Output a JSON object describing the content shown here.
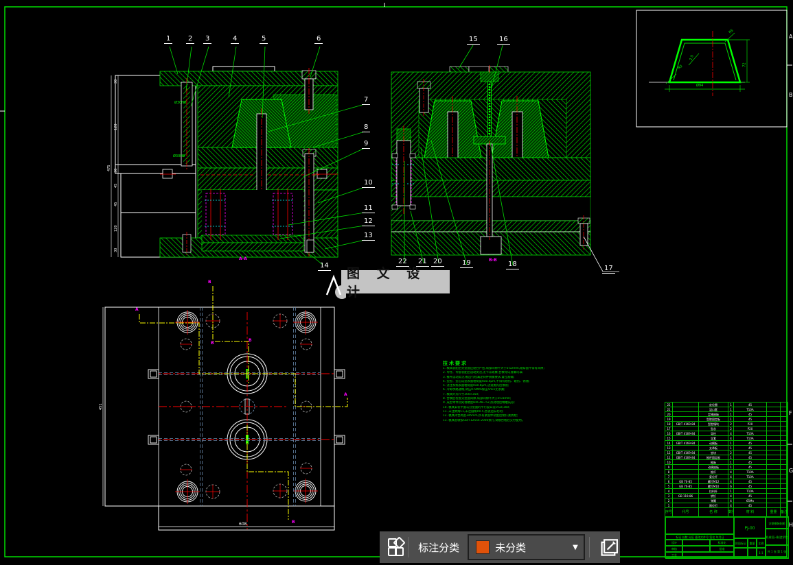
{
  "colors": {
    "line_green": "#00DC00",
    "hatch_green": "#00C800",
    "bright_green": "#00FF00",
    "red": "#FF0000",
    "yellow": "#FFFF00",
    "magenta": "#FF00FF",
    "cyan": "#00FFFF",
    "white": "#FFFFFF",
    "toolbar_bg": "#4D4D4D",
    "swatch_orange": "#E0520A",
    "watermark_bg": "#C4C4C4"
  },
  "sheet": {
    "zones": [
      "A",
      "B",
      "F",
      "G",
      "H"
    ]
  },
  "callouts": {
    "a": [
      "1",
      "2",
      "3",
      "4",
      "5",
      "6",
      "7",
      "8",
      "9",
      "10",
      "11",
      "12",
      "13",
      "14"
    ],
    "b": [
      "15",
      "16",
      "17",
      "18",
      "19",
      "20",
      "21",
      "22"
    ]
  },
  "views": {
    "section_a": {
      "label": "A-A",
      "dim_chain": [
        "30",
        "120",
        "30",
        "45",
        "45",
        "120",
        "30"
      ],
      "dim_overall": "475",
      "bolt_labels": [
        "Ø30H8",
        "Ø30H8"
      ]
    },
    "section_b": {
      "label": "B-B"
    },
    "plan": {
      "dim_width": "608",
      "dim_height": "451",
      "mark_a": "A",
      "mark_b": "B"
    },
    "detail": {
      "r_top": "R5",
      "r_side": "R2",
      "width": "Ø94",
      "height": "72",
      "wall": "2.5"
    }
  },
  "notes": {
    "title": "技术要求",
    "lines": [
      "1. 模具装配后分型面应贴合严密,局部间隙不大于0.02mm,碰穿面不得有间隙;",
      "2. 导柱、导套装配后运动灵活,无卡滞现象,合模导向准确可靠;",
      "3. 推杆运动灵活,推出行程满足制件脱模要求,复位准确;",
      "4. 型腔、型芯成型表面粗糙度Ra0.4μm,不得有划伤、碰伤、锈蚀;",
      "5. 浇注系统表面粗糙度Ra0.8μm,浇道抛光后镀铬;",
      "6. 冷却水路通畅,试压0.5MPa保压5min无渗漏;",
      "7. 模具外形尺寸300×350;",
      "8. 合模后检查分型面间隙,局部间隙不大于0.03mm;",
      "9. 成型零件热处理硬度HRC48~52,热处理后精磨成形;",
      "10. 模具安装平面与分型面的平行度公差0.02/300;",
      "11. 未注倒角C1,未注圆角R0.5,各锐边去毛刺;",
      "12. 模具闭合高度345mm,所有紧固件装配后需拧紧防松;",
      "13. 模具验收按GB/T12554-2006执行,试模合格后交付使用。"
    ]
  },
  "parts_list": {
    "headers": [
      "序号",
      "代号",
      "名 称",
      "数量",
      "材 料",
      "重量",
      "备注"
    ],
    "rows": [
      [
        "22",
        "",
        "定位圈",
        "1",
        "45",
        "",
        ""
      ],
      [
        "21",
        "",
        "浇口套",
        "1",
        "T10A",
        "",
        ""
      ],
      [
        "20",
        "",
        "定模座板",
        "1",
        "45",
        "",
        ""
      ],
      [
        "19",
        "",
        "型腔固定板",
        "1",
        "45",
        "",
        ""
      ],
      [
        "18",
        "GB/T 4169-84",
        "型腔镶块",
        "2",
        "P20",
        "",
        ""
      ],
      [
        "17",
        "",
        "型芯",
        "2",
        "P20",
        "",
        ""
      ],
      [
        "16",
        "GB/T 4169-84",
        "导柱",
        "4",
        "T10A",
        "",
        ""
      ],
      [
        "15",
        "",
        "导套",
        "4",
        "T10A",
        "",
        ""
      ],
      [
        "14",
        "GB/T 4169-84",
        "动模板",
        "1",
        "45",
        "",
        ""
      ],
      [
        "13",
        "",
        "支承板",
        "1",
        "45",
        "",
        ""
      ],
      [
        "12",
        "GB/T 4169-84",
        "垫块",
        "2",
        "45",
        "",
        ""
      ],
      [
        "11",
        "GB/T 4169-84",
        "推杆固定板",
        "1",
        "45",
        "",
        ""
      ],
      [
        "10",
        "",
        "推板",
        "1",
        "45",
        "",
        ""
      ],
      [
        "9",
        "",
        "动模座板",
        "1",
        "45",
        "",
        ""
      ],
      [
        "8",
        "",
        "推杆",
        "4",
        "T10A",
        "",
        ""
      ],
      [
        "7",
        "",
        "复位杆",
        "4",
        "T10A",
        "",
        ""
      ],
      [
        "6",
        "GB 70-85",
        "螺钉M12",
        "4",
        "45",
        "",
        ""
      ],
      [
        "5",
        "GB 70-85",
        "螺钉M10",
        "6",
        "45",
        "",
        ""
      ],
      [
        "4",
        "",
        "拉料杆",
        "1",
        "T10A",
        "",
        ""
      ],
      [
        "3",
        "GB 119-86",
        "销钉",
        "4",
        "45",
        "",
        ""
      ],
      [
        "2",
        "",
        "弹簧",
        "4",
        "65Mn",
        "",
        ""
      ],
      [
        "1",
        "",
        "限位钉",
        "4",
        "45",
        "",
        ""
      ]
    ]
  },
  "title_block": {
    "drawing_number": "PJ-00",
    "title": "注塑模装配图",
    "org": "机械设计制造学院",
    "row_labels": "标记 处数 分区 更改文件号 签名 年月日",
    "design_label": "设计",
    "check_label": "审核",
    "process_label": "工艺",
    "std_label": "标准化",
    "approve_label": "批准",
    "stage_label": "阶段标记",
    "weight_label": "重量",
    "scale_label": "比例",
    "scale_value": "1:1",
    "sheet_label": "共 1 张 第 1 张"
  },
  "watermark": {
    "text": "图 文 设 计"
  },
  "toolbar": {
    "label": "标注分类",
    "dropdown_value": "未分类",
    "caret": "▼",
    "icons": {
      "left": "categories-icon",
      "right": "edit-annotation-icon"
    }
  }
}
